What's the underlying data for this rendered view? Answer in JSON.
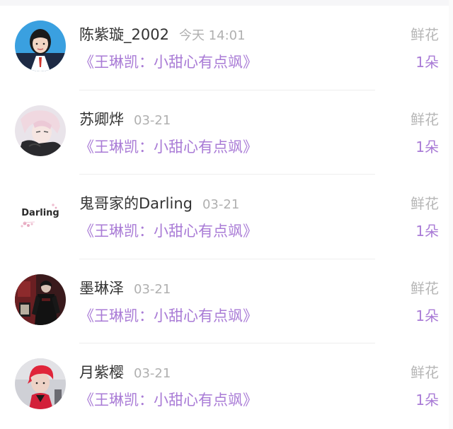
{
  "gift_records": [
    {
      "user": "陈紫璇_2002",
      "time": "今天 14:01",
      "work_title": "《王琳凯：小甜心有点飒》",
      "gift_type": "鲜花",
      "gift_count": "1朵",
      "avatar_icon": "girl-portrait-avatar"
    },
    {
      "user": "苏卿烨",
      "time": "03-21",
      "work_title": "《王琳凯：小甜心有点飒》",
      "gift_type": "鲜花",
      "gift_count": "1朵",
      "avatar_icon": "anime-boy-avatar"
    },
    {
      "user": "鬼哥家的Darling",
      "time": "03-21",
      "work_title": "《王琳凯：小甜心有点飒》",
      "gift_type": "鲜花",
      "gift_count": "1朵",
      "avatar_icon": "darling-text-avatar",
      "avatar_text": "Darling"
    },
    {
      "user": "墨琳泽",
      "time": "03-21",
      "work_title": "《王琳凯：小甜心有点飒》",
      "gift_type": "鲜花",
      "gift_count": "1朵",
      "avatar_icon": "dark-figure-avatar"
    },
    {
      "user": "月紫樱",
      "time": "03-21",
      "work_title": "《王琳凯：小甜心有点飒》",
      "gift_type": "鲜花",
      "gift_count": "1朵",
      "avatar_icon": "red-hair-avatar"
    }
  ],
  "colors": {
    "accent_purple": "#a97bd6",
    "name_text": "#333333",
    "muted_text": "#b0b0b0"
  }
}
